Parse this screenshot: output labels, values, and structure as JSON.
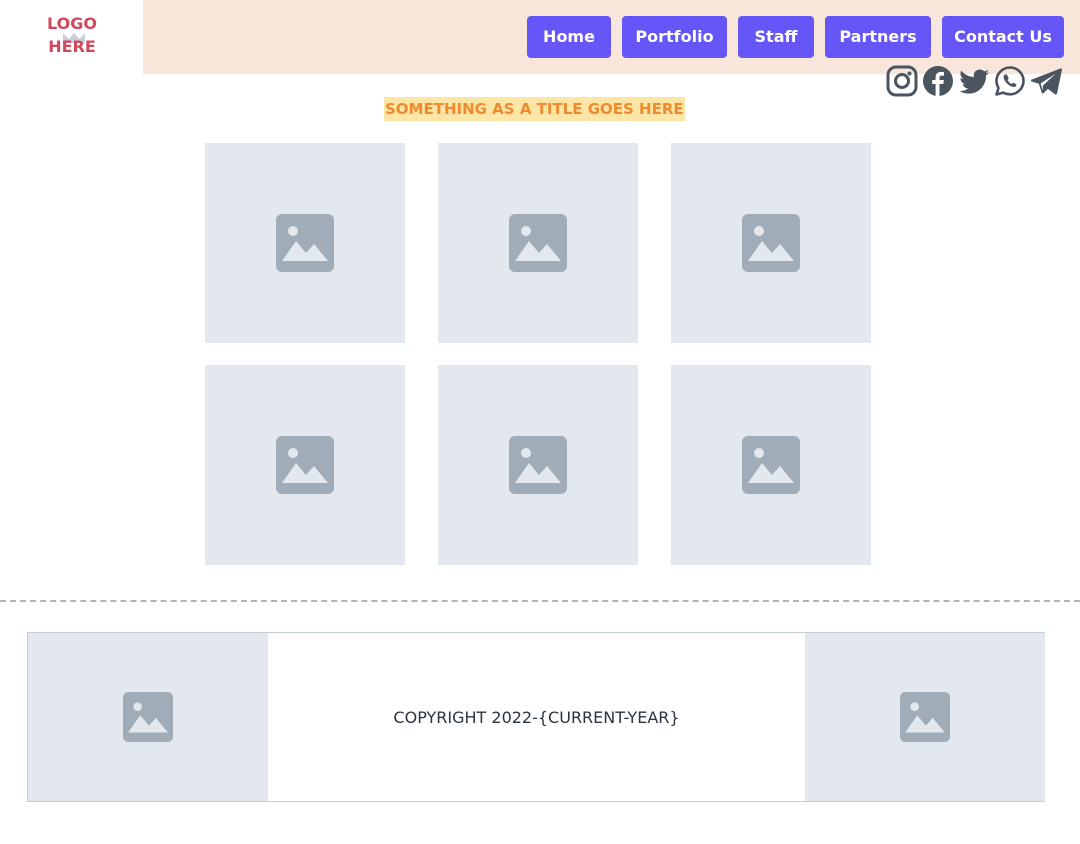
{
  "logo": {
    "line1": "LOGO",
    "line2": "HERE"
  },
  "nav": {
    "home": "Home",
    "portfolio": "Portfolio",
    "staff": "Staff",
    "partners": "Partners",
    "contact": "Contact Us"
  },
  "social": [
    "instagram-icon",
    "facebook-icon",
    "twitter-icon",
    "whatsapp-icon",
    "telegram-icon"
  ],
  "title": "SOMETHING AS A TITLE GOES HERE",
  "gallery": [
    "image-placeholder",
    "image-placeholder",
    "image-placeholder",
    "image-placeholder",
    "image-placeholder",
    "image-placeholder"
  ],
  "footer": {
    "copyright": "COPYRIGHT 2022-{CURRENT-YEAR}"
  },
  "colors": {
    "header_bg": "#f9e6da",
    "nav_button": "#6655f7",
    "logo": "#d0485e",
    "title_text": "#f08a2e",
    "title_highlight": "#fde5a6",
    "placeholder_bg": "#e2e8ee",
    "placeholder_icon": "#a0adb8",
    "social_icon": "#4a5560"
  }
}
